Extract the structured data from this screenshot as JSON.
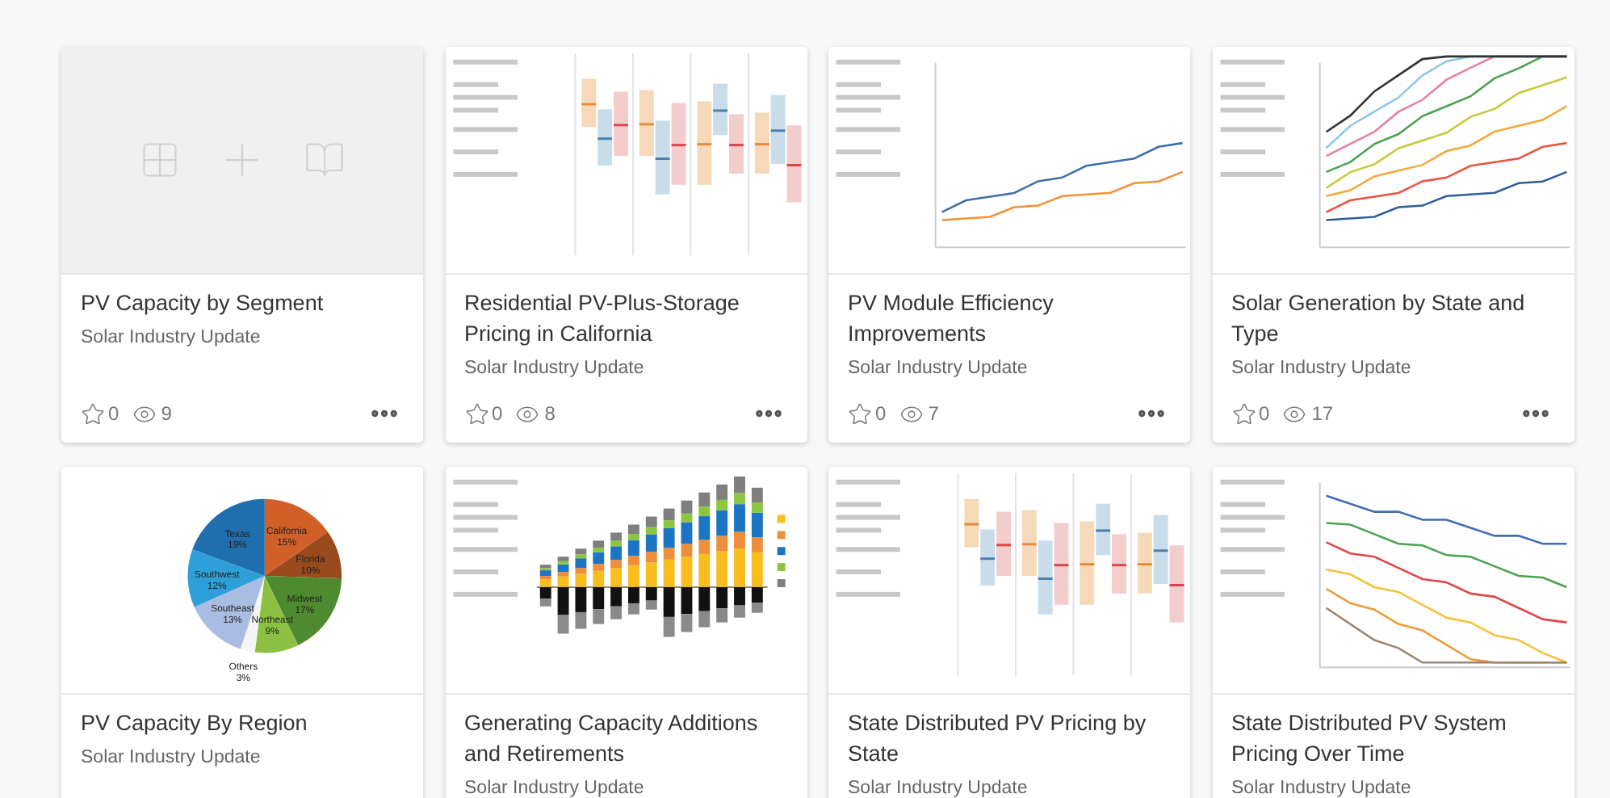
{
  "cards": [
    {
      "title": "PV Capacity by Segment",
      "subtitle": "Solar Industry Update",
      "favorites": "0",
      "views": "9",
      "thumbnail": {
        "kind": "placeholder"
      }
    },
    {
      "title": "Residential PV-Plus-Storage Pricing in California",
      "subtitle": "Solar Industry Update",
      "favorites": "0",
      "views": "8",
      "thumbnail": {
        "kind": "boxplot"
      }
    },
    {
      "title": "PV Module Efficiency Improvements",
      "subtitle": "Solar Industry Update",
      "favorites": "0",
      "views": "7",
      "thumbnail": {
        "kind": "line"
      }
    },
    {
      "title": "Solar Generation by State and Type",
      "subtitle": "Solar Industry Update",
      "favorites": "0",
      "views": "17",
      "thumbnail": {
        "kind": "multiline"
      }
    },
    {
      "title": "PV Capacity By Region",
      "subtitle": "Solar Industry Update",
      "thumbnail": {
        "kind": "pie",
        "chart_data": {
          "type": "pie",
          "categories": [
            "California",
            "Florida",
            "Midwest",
            "Northeast",
            "Others",
            "Southeast",
            "Southwest",
            "Texas"
          ],
          "values": [
            15,
            10,
            17,
            9,
            3,
            13,
            12,
            19
          ],
          "value_labels": [
            "15%",
            "10%",
            "17%",
            "9%",
            "3%",
            "13%",
            "12%",
            "19%"
          ]
        }
      }
    },
    {
      "title": "Generating Capacity Additions and Retirements",
      "subtitle": "Solar Industry Update",
      "thumbnail": {
        "kind": "stacked_bar"
      }
    },
    {
      "title": "State Distributed PV Pricing by State",
      "subtitle": "Solar Industry Update",
      "thumbnail": {
        "kind": "boxplot"
      }
    },
    {
      "title": "State Distributed PV System Pricing Over Time",
      "subtitle": "Solar Industry Update",
      "thumbnail": {
        "kind": "multiline_down"
      }
    }
  ]
}
